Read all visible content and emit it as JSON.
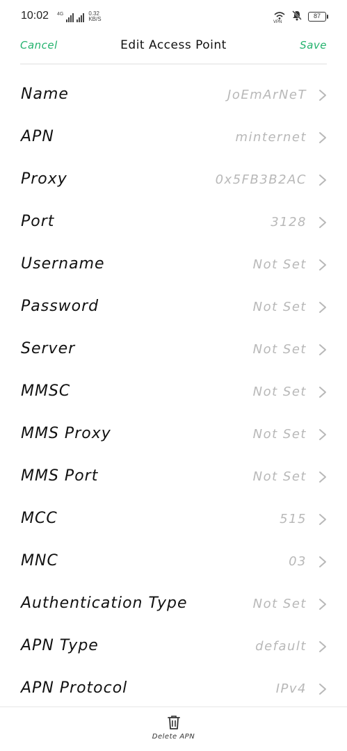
{
  "status_bar": {
    "time": "10:02",
    "network_tag": "4G",
    "speed_value": "0.32",
    "speed_unit": "KB/S",
    "vpn_label": "VPN",
    "battery": "87"
  },
  "header": {
    "cancel_label": "Cancel",
    "title": "Edit Access Point",
    "save_label": "Save"
  },
  "rows": [
    {
      "label": "Name",
      "value": "JoEmArNeT"
    },
    {
      "label": "APN",
      "value": "minternet"
    },
    {
      "label": "Proxy",
      "value": "0x5FB3B2AC"
    },
    {
      "label": "Port",
      "value": "3128"
    },
    {
      "label": "Username",
      "value": "Not Set"
    },
    {
      "label": "Password",
      "value": "Not Set"
    },
    {
      "label": "Server",
      "value": "Not Set"
    },
    {
      "label": "MMSC",
      "value": "Not Set"
    },
    {
      "label": "MMS Proxy",
      "value": "Not Set"
    },
    {
      "label": "MMS Port",
      "value": "Not Set"
    },
    {
      "label": "MCC",
      "value": "515"
    },
    {
      "label": "MNC",
      "value": "03"
    },
    {
      "label": "Authentication Type",
      "value": "Not Set"
    },
    {
      "label": "APN Type",
      "value": "default"
    },
    {
      "label": "APN Protocol",
      "value": "IPv4"
    }
  ],
  "footer": {
    "delete_label": "Delete APN",
    "delete_icon": "trash-icon"
  },
  "colors": {
    "accent": "#23b26d",
    "value_text": "#b8b8b8",
    "label_text": "#111111"
  }
}
